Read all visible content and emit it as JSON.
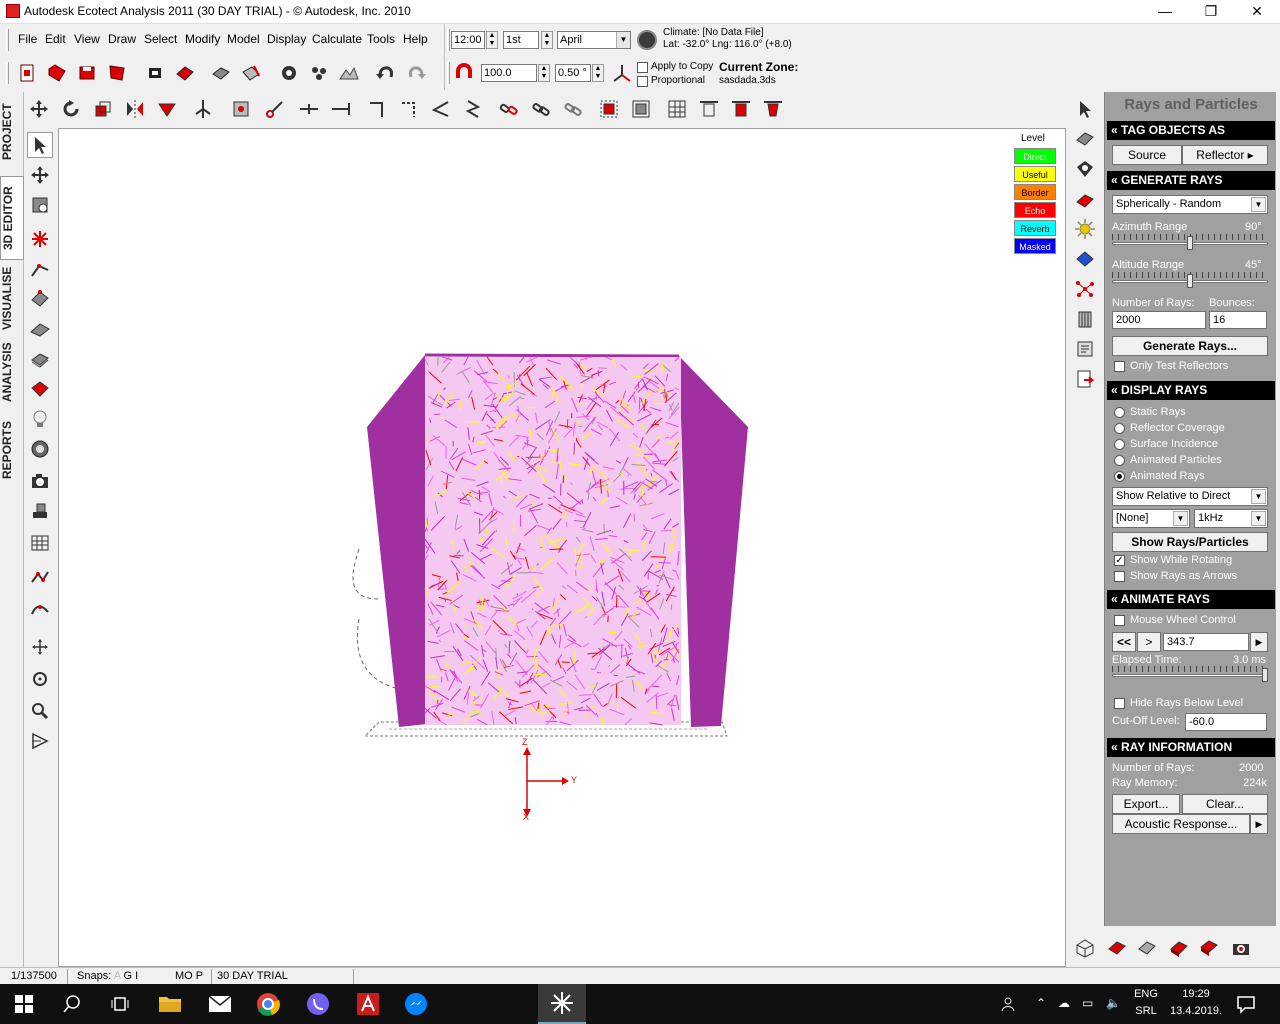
{
  "window": {
    "title": "Autodesk Ecotect Analysis 2011 (30 DAY TRIAL) - © Autodesk, Inc. 2010",
    "minimize": "—",
    "maximize": "❐",
    "close": "✕"
  },
  "menu": [
    "File",
    "Edit",
    "View",
    "Draw",
    "Select",
    "Modify",
    "Model",
    "Display",
    "Calculate",
    "Tools",
    "Help"
  ],
  "time_controls": {
    "time": "12:00",
    "day": "1st",
    "month": "April",
    "climate": "Climate: [No Data File]",
    "latlng": "Lat: -32.0°   Lng: 116.0° (+8.0)"
  },
  "transform_controls": {
    "value": "100.0",
    "step": "0.50 °",
    "apply_to_copy": "Apply to Copy",
    "proportional": "Proportional",
    "current_zone_label": "Current Zone:",
    "current_zone": "sasdada.3ds"
  },
  "left_tabs": [
    "PROJECT",
    "3D EDITOR",
    "VISUALISE",
    "ANALYSIS",
    "REPORTS"
  ],
  "legend": {
    "title": "Level",
    "items": [
      {
        "label": "Direct",
        "color": "#00ff00",
        "text": "#ffffff"
      },
      {
        "label": "Useful",
        "color": "#ffff00",
        "text": "#000000"
      },
      {
        "label": "Border",
        "color": "#ff8000",
        "text": "#000000"
      },
      {
        "label": "Echo",
        "color": "#ff0000",
        "text": "#ffffff"
      },
      {
        "label": "Reverb",
        "color": "#00ffff",
        "text": "#000000"
      },
      {
        "label": "Masked",
        "color": "#0000ff",
        "text": "#ffffff"
      }
    ]
  },
  "axes": {
    "z": "Z",
    "y": "Y",
    "x": "X"
  },
  "panel": {
    "title": "Rays and Particles",
    "tag_objects": {
      "header": "TAG OBJECTS AS",
      "source": "Source",
      "reflector": "Reflector"
    },
    "generate_rays": {
      "header": "GENERATE RAYS",
      "mode": "Spherically - Random",
      "azimuth_label": "Azimuth Range",
      "azimuth_value": "90°",
      "azimuth_fraction": 0.5,
      "altitude_label": "Altitude Range",
      "altitude_value": "45°",
      "altitude_fraction": 0.5,
      "num_rays_label": "Number of Rays:",
      "bounces_label": "Bounces:",
      "num_rays": "2000",
      "bounces": "16",
      "generate_button": "Generate Rays...",
      "only_test": "Only Test Reflectors"
    },
    "display_rays": {
      "header": "DISPLAY RAYS",
      "options": [
        "Static Rays",
        "Reflector Coverage",
        "Surface Incidence",
        "Animated Particles",
        "Animated Rays"
      ],
      "selected": 4,
      "relative": "Show Relative to Direct",
      "filter": "[None]",
      "freq": "1kHz",
      "show_button": "Show Rays/Particles",
      "show_while_rotating": "Show While Rotating",
      "show_as_arrows": "Show Rays as Arrows"
    },
    "animate_rays": {
      "header": "ANIMATE RAYS",
      "mouse_wheel": "Mouse Wheel Control",
      "rewind": "<<",
      "step": ">",
      "position": "343.7",
      "elapsed_label": "Elapsed Time:",
      "elapsed_value": "3.0 ms",
      "elapsed_fraction": 1.0,
      "hide_below": "Hide Rays Below Level",
      "cutoff_label": "Cut-Off Level:",
      "cutoff_value": "-60.0"
    },
    "ray_information": {
      "header": "RAY INFORMATION",
      "num_rays_label": "Number of Rays:",
      "num_rays_value": "2000",
      "memory_label": "Ray Memory:",
      "memory_value": "224k",
      "export": "Export...",
      "clear": "Clear...",
      "acoustic": "Acoustic Response..."
    }
  },
  "statusbar": {
    "scale": "1/137500",
    "snaps_label": "Snaps:",
    "snaps_a": "A",
    "snaps_gi": "G I",
    "snaps_mop": "MO P",
    "trial": "30 DAY TRIAL"
  },
  "taskbar": {
    "language": "ENG",
    "layout": "SRL",
    "time": "19:29",
    "date": "13.4.2019."
  }
}
